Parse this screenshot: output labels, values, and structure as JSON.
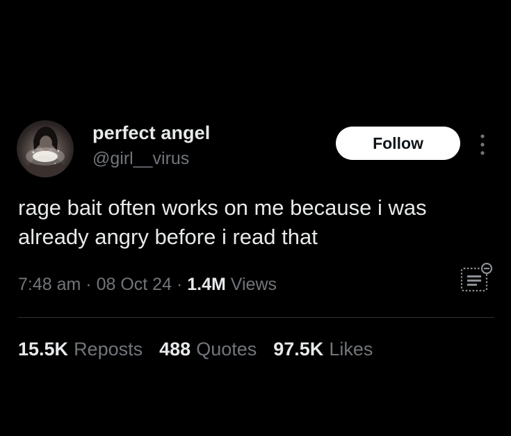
{
  "user": {
    "display_name": "perfect angel",
    "handle": "@girl__virus"
  },
  "actions": {
    "follow_label": "Follow"
  },
  "tweet": {
    "text": "rage bait often works on me because i was already angry before i read that"
  },
  "meta": {
    "time": "7:48 am",
    "separator_1": "·",
    "date": "08 Oct 24",
    "separator_2": "·",
    "views_count": "1.4M",
    "views_label": "Views"
  },
  "stats": {
    "reposts_count": "15.5K",
    "reposts_label": "Reposts",
    "quotes_count": "488",
    "quotes_label": "Quotes",
    "likes_count": "97.5K",
    "likes_label": "Likes"
  },
  "icons": {
    "more": "more-vertical-icon",
    "analytics": "post-analytics-icon"
  },
  "colors": {
    "background": "#000000",
    "primary_text": "#e7e9ea",
    "secondary_text": "#71767b",
    "follow_button_bg": "#ffffff",
    "divider": "#2f3336"
  }
}
